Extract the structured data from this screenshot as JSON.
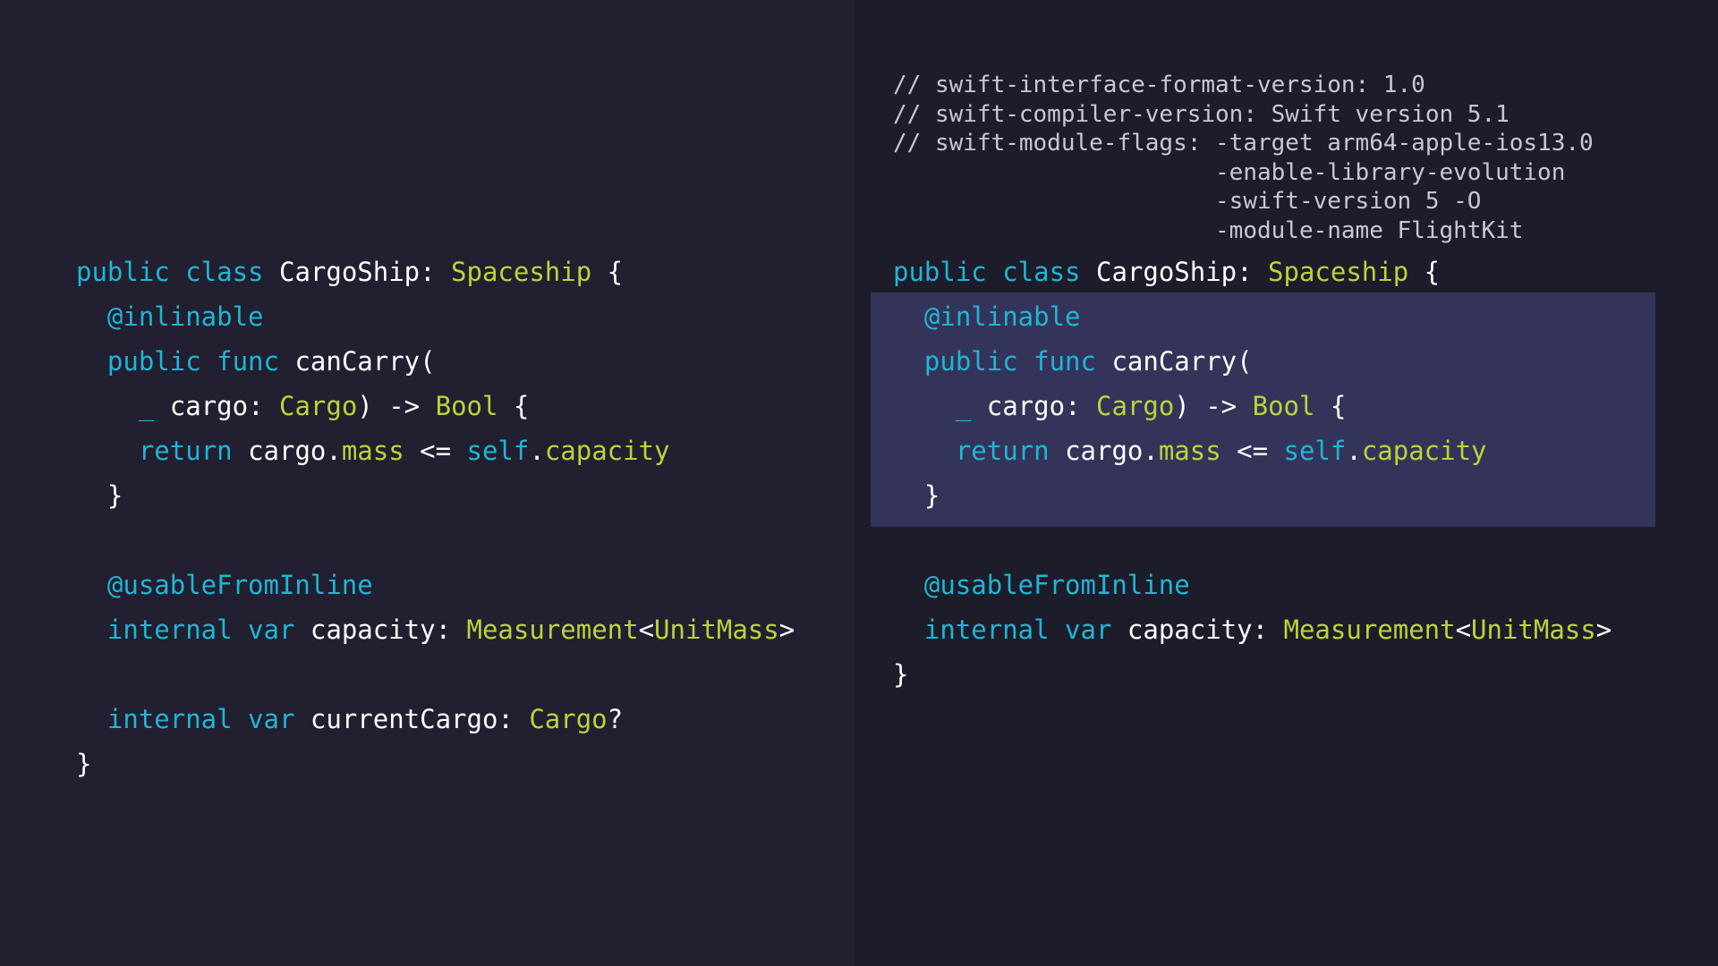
{
  "header_comments": [
    "// swift-interface-format-version: 1.0",
    "// swift-compiler-version: Swift version 5.1",
    "// swift-module-flags: -target arm64-apple-ios13.0",
    "                       -enable-library-evolution",
    "                       -swift-version 5 -O",
    "                       -module-name FlightKit"
  ],
  "colors": {
    "background_left": "#211f30",
    "background_right": "#1d1c2b",
    "highlight": "#34345a",
    "keyword": "#1fb6d4",
    "type": "#b9d53a",
    "identifier": "#ffffff",
    "comment": "#c9c8d2"
  },
  "left_code": [
    [
      {
        "t": "public class ",
        "c": "kw"
      },
      {
        "t": "CargoShip: ",
        "c": "id"
      },
      {
        "t": "Spaceship",
        "c": "ty"
      },
      {
        "t": " {",
        "c": "pu"
      }
    ],
    [
      {
        "t": "  @inlinable",
        "c": "kw"
      }
    ],
    [
      {
        "t": "  public func ",
        "c": "kw"
      },
      {
        "t": "canCarry(",
        "c": "id"
      }
    ],
    [
      {
        "t": "    _ ",
        "c": "kw"
      },
      {
        "t": "cargo: ",
        "c": "id"
      },
      {
        "t": "Cargo",
        "c": "ty"
      },
      {
        "t": ") -> ",
        "c": "pu"
      },
      {
        "t": "Bool",
        "c": "ty"
      },
      {
        "t": " {",
        "c": "pu"
      }
    ],
    [
      {
        "t": "    return ",
        "c": "kw"
      },
      {
        "t": "cargo.",
        "c": "id"
      },
      {
        "t": "mass",
        "c": "ty"
      },
      {
        "t": " <= ",
        "c": "pu"
      },
      {
        "t": "self",
        "c": "kw"
      },
      {
        "t": ".",
        "c": "pu"
      },
      {
        "t": "capacity",
        "c": "ty"
      }
    ],
    [
      {
        "t": "  }",
        "c": "pu"
      }
    ],
    [],
    [
      {
        "t": "  @usableFromInline",
        "c": "kw"
      }
    ],
    [
      {
        "t": "  internal var ",
        "c": "kw"
      },
      {
        "t": "capacity: ",
        "c": "id"
      },
      {
        "t": "Measurement",
        "c": "ty"
      },
      {
        "t": "<",
        "c": "pu"
      },
      {
        "t": "UnitMass",
        "c": "ty"
      },
      {
        "t": ">",
        "c": "pu"
      }
    ],
    [],
    [
      {
        "t": "  internal var ",
        "c": "kw"
      },
      {
        "t": "currentCargo: ",
        "c": "id"
      },
      {
        "t": "Cargo",
        "c": "ty"
      },
      {
        "t": "?",
        "c": "pu"
      }
    ],
    [
      {
        "t": "}",
        "c": "pu"
      }
    ]
  ],
  "right_code": [
    [
      {
        "t": "public class ",
        "c": "kw"
      },
      {
        "t": "CargoShip: ",
        "c": "id"
      },
      {
        "t": "Spaceship",
        "c": "ty"
      },
      {
        "t": " {",
        "c": "pu"
      }
    ],
    [
      {
        "t": "  @inlinable",
        "c": "kw"
      }
    ],
    [
      {
        "t": "  public func ",
        "c": "kw"
      },
      {
        "t": "canCarry(",
        "c": "id"
      }
    ],
    [
      {
        "t": "    _ ",
        "c": "kw"
      },
      {
        "t": "cargo: ",
        "c": "id"
      },
      {
        "t": "Cargo",
        "c": "ty"
      },
      {
        "t": ") -> ",
        "c": "pu"
      },
      {
        "t": "Bool",
        "c": "ty"
      },
      {
        "t": " {",
        "c": "pu"
      }
    ],
    [
      {
        "t": "    return ",
        "c": "kw"
      },
      {
        "t": "cargo.",
        "c": "id"
      },
      {
        "t": "mass",
        "c": "ty"
      },
      {
        "t": " <= ",
        "c": "pu"
      },
      {
        "t": "self",
        "c": "kw"
      },
      {
        "t": ".",
        "c": "pu"
      },
      {
        "t": "capacity",
        "c": "ty"
      }
    ],
    [
      {
        "t": "  }",
        "c": "pu"
      }
    ],
    [],
    [
      {
        "t": "  @usableFromInline",
        "c": "kw"
      }
    ],
    [
      {
        "t": "  internal var ",
        "c": "kw"
      },
      {
        "t": "capacity: ",
        "c": "id"
      },
      {
        "t": "Measurement",
        "c": "ty"
      },
      {
        "t": "<",
        "c": "pu"
      },
      {
        "t": "UnitMass",
        "c": "ty"
      },
      {
        "t": ">",
        "c": "pu"
      }
    ],
    [
      {
        "t": "}",
        "c": "pu"
      }
    ]
  ]
}
